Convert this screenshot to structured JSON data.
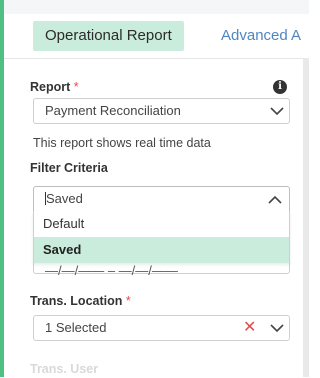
{
  "tabs": [
    {
      "label": "Operational Report",
      "active": true
    },
    {
      "label": "Advanced A",
      "active": false
    }
  ],
  "report": {
    "label": "Report",
    "required_mark": "*",
    "selected": "Payment Reconciliation",
    "help_text": "This report shows real time data"
  },
  "filter_criteria": {
    "label": "Filter Criteria",
    "input_value": "Saved",
    "options": [
      {
        "label": "Default",
        "selected": false
      },
      {
        "label": "Saved",
        "selected": true
      }
    ]
  },
  "date_range": {
    "partial_text": "—/—/—— – —/—/——"
  },
  "trans_location": {
    "label": "Trans. Location",
    "required_mark": "*",
    "selected": "1 Selected"
  },
  "next_label": "Trans. User",
  "colors": {
    "accent_green": "#4fbf83",
    "active_tab_bg": "#c9ecdc",
    "link_blue": "#4e86c1",
    "required_red": "#e24b4b"
  },
  "icons": [
    "info-icon",
    "chevron-down-icon",
    "chevron-up-icon",
    "clear-x-icon"
  ]
}
